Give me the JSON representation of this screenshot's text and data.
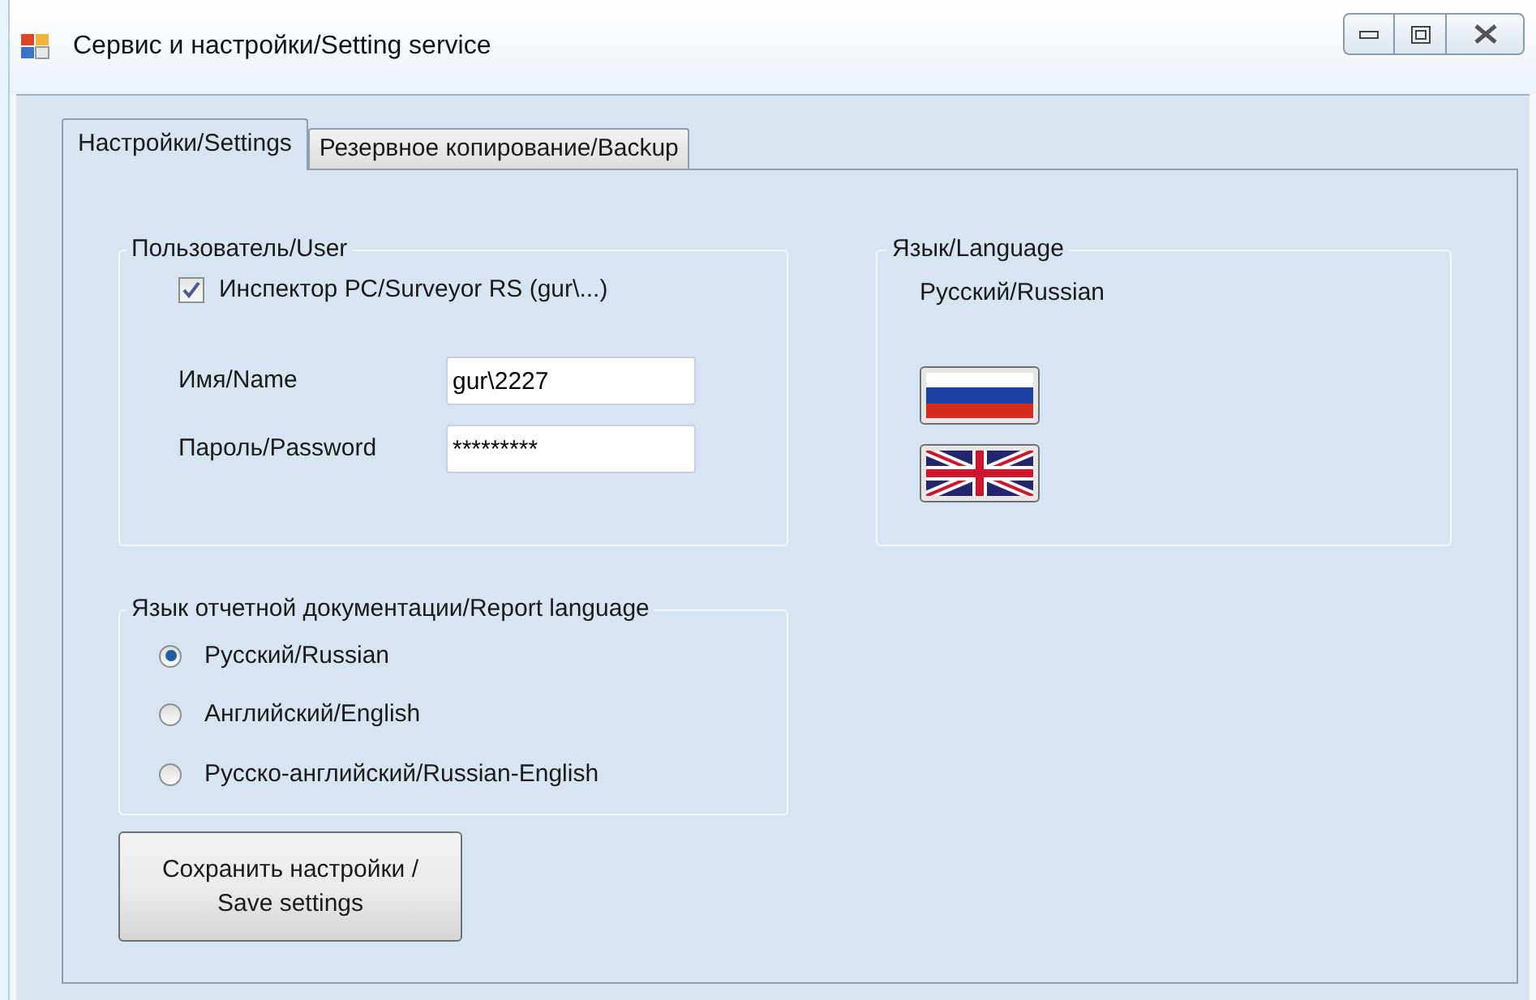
{
  "window": {
    "title": "Сервис и настройки/Setting service"
  },
  "tabs": [
    {
      "label": "Настройки/Settings",
      "selected": true
    },
    {
      "label": "Резервное копирование/Backup",
      "selected": false
    }
  ],
  "user_group": {
    "title": "Пользователь/User",
    "checkbox": {
      "label": "Инспектор РС/Surveyor RS (gur\\...)",
      "checked": true
    },
    "fields": [
      {
        "label": "Имя/Name",
        "value": "gur\\2227"
      },
      {
        "label": "Пароль/Password",
        "value": "*********"
      }
    ]
  },
  "language_group": {
    "title": "Язык/Language",
    "current": "Русский/Russian",
    "flags": [
      {
        "kind": "ru"
      },
      {
        "kind": "gb"
      }
    ]
  },
  "report_group": {
    "title": "Язык отчетной документации/Report language",
    "options": [
      {
        "label": "Русский/Russian",
        "selected": true
      },
      {
        "label": "Английский/English",
        "selected": false
      },
      {
        "label": "Русско-английский/Russian-English",
        "selected": false
      }
    ]
  },
  "save_button": {
    "label": "Сохранить настройки /\nSave settings"
  }
}
